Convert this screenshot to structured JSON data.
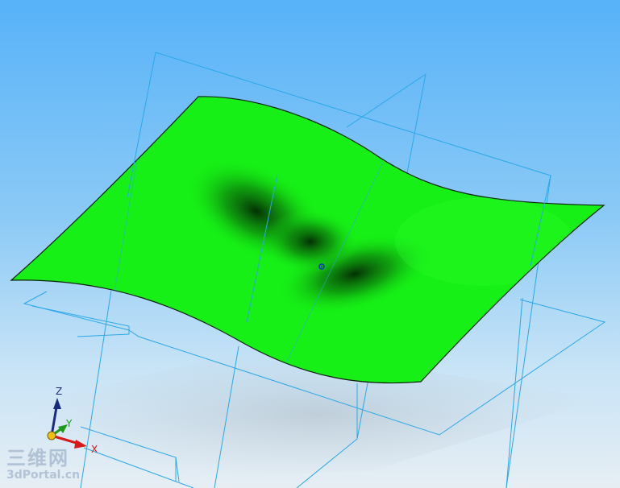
{
  "scene": {
    "surface_color": "#16f016",
    "plane_color": "#2aa8e8"
  },
  "triad": {
    "x_label": "X",
    "y_label": "Y",
    "z_label": "Z",
    "x_color": "#d41a1a",
    "y_color": "#1b9a1b",
    "z_color": "#1a2a80"
  },
  "watermark": {
    "text_cn": "三维网",
    "text_en": "3dPortal.cn"
  }
}
